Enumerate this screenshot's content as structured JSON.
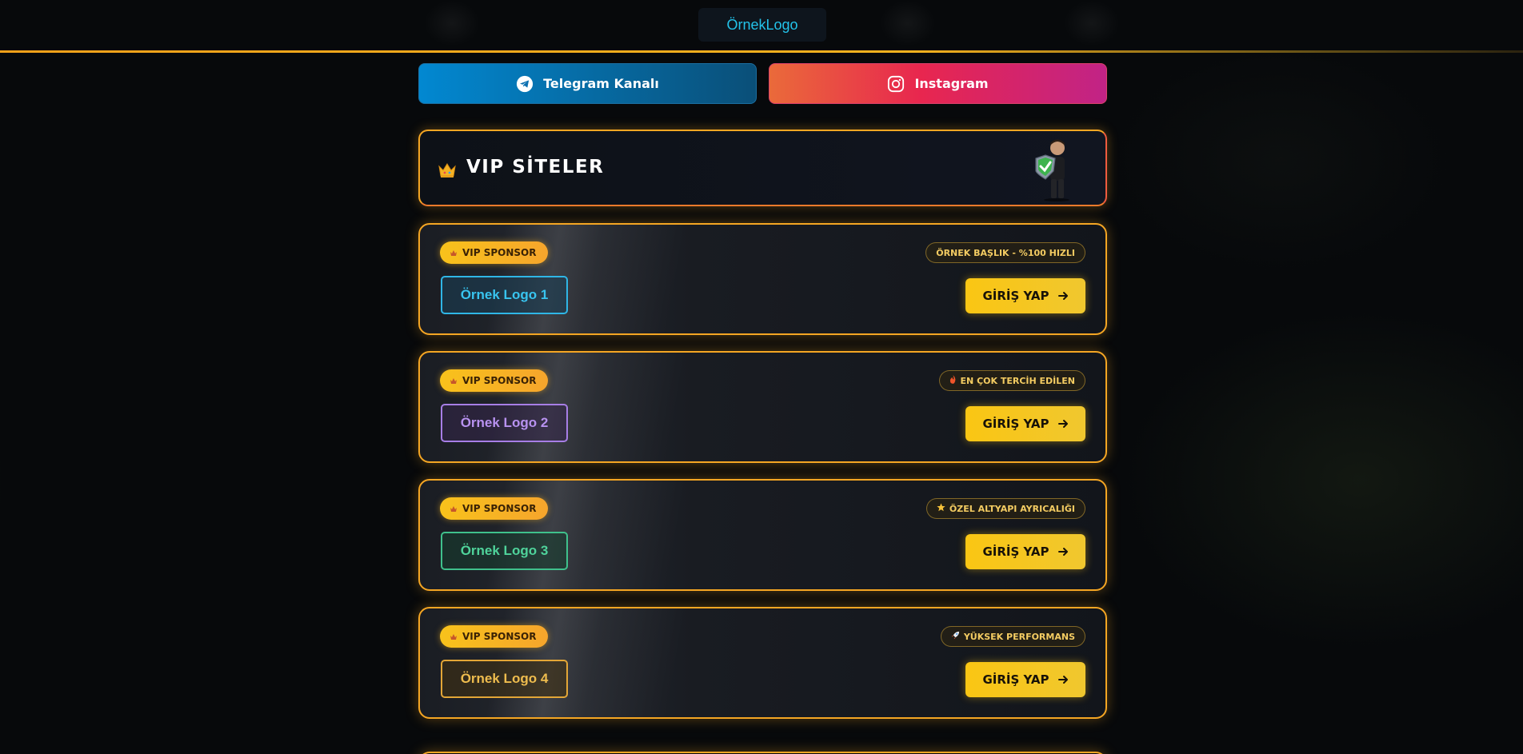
{
  "header": {
    "logo": "ÖrnekLogo"
  },
  "social": {
    "telegram_label": "Telegram Kanalı",
    "instagram_label": "Instagram"
  },
  "vip_header": {
    "title": "VIP SİTELER"
  },
  "colors": {
    "accent": "#f5a623",
    "cta": "#fac613",
    "telegram": "#0288d1",
    "instagram": "#e8264f"
  },
  "cards": [
    {
      "badge": "VIP SPONSOR",
      "tag": "ÖRNEK BAŞLIK - %100 HIZLI",
      "tag_icon": "",
      "logo": "Örnek Logo 1",
      "cta": "GİRİŞ YAP"
    },
    {
      "badge": "VIP SPONSOR",
      "tag": "EN ÇOK TERCİH EDİLEN",
      "tag_icon": "fire-icon",
      "logo": "Örnek Logo 2",
      "cta": "GİRİŞ YAP"
    },
    {
      "badge": "VIP SPONSOR",
      "tag": "ÖZEL ALTYAPI AYRICALIĞI",
      "tag_icon": "star-icon",
      "logo": "Örnek Logo 3",
      "cta": "GİRİŞ YAP"
    },
    {
      "badge": "VIP SPONSOR",
      "tag": "YÜKSEK PERFORMANS",
      "tag_icon": "rocket-icon",
      "logo": "Örnek Logo 4",
      "cta": "GİRİŞ YAP"
    }
  ]
}
